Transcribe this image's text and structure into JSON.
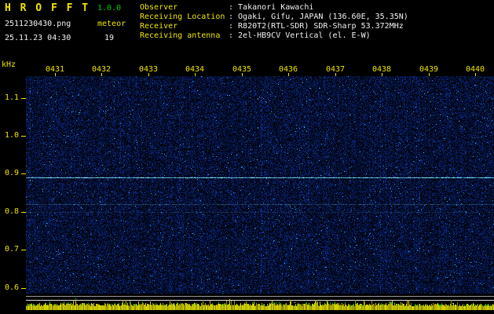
{
  "app": {
    "title": "H R O F F T",
    "version": "1.0.0",
    "filename": "2511230430.png",
    "mode_label": "meteor",
    "datetime": "25.11.23 04:30",
    "echo_count": "19"
  },
  "info": {
    "separator": ":",
    "rows": [
      {
        "label": "Observer",
        "value": "Takanori Kawachi"
      },
      {
        "label": "Receiving Location",
        "value": "Ogaki, Gifu, JAPAN (136.60E, 35.35N)"
      },
      {
        "label": "Receiver",
        "value": "R820T2(RTL-SDR) SDR-Sharp 53.372MHz"
      },
      {
        "label": "Receiving antenna",
        "value": "2el-HB9CV Vertical (el. E-W)"
      }
    ]
  },
  "colors": {
    "background": "#000000",
    "label_yellow": "#f0e300",
    "version_green": "#00cc00",
    "text_white": "#f2f2f2",
    "noise_blue": "#1414b4",
    "carrier_cyan": "#64e6ff",
    "strip_yellow": "#d2d200",
    "strip_green": "#00b400",
    "ref_line_gray": "#9a9a9a",
    "ref_line_white": "#e6e6e6"
  },
  "chart_data": {
    "type": "heatmap",
    "title": "HROFFT 10-minute radio meteor echo spectrogram",
    "x_tick_labels": [
      "0431",
      "0432",
      "0433",
      "0434",
      "0435",
      "0436",
      "0437",
      "0438",
      "0439",
      "0440"
    ],
    "x_axis_note": "time of day (hhmm), 1-minute intervals, 25.11.23 04:30-04:40",
    "ylabel": "kHz",
    "y_tick_labels": [
      "1.1",
      "1.0",
      "0.9",
      "0.8",
      "0.7",
      "0.6"
    ],
    "y_ticks_khz": [
      1.1,
      1.0,
      0.9,
      0.8,
      0.7,
      0.6
    ],
    "ylim_khz": [
      0.585,
      1.157
    ],
    "grid": false,
    "legend": false,
    "background_note": "dark blue random noise speckle field",
    "carrier_lines": [
      {
        "khz": 0.89,
        "strength": 1.0,
        "appearance": "bright continuous cyan carrier line"
      },
      {
        "khz": 0.82,
        "strength": 0.3,
        "appearance": "faint intermittent cyan line"
      },
      {
        "khz": 0.8,
        "strength": 0.16,
        "appearance": "very faint intermittent cyan line"
      }
    ],
    "bottom_strip_note": "yellow signal-level noise band with green flecks and two horizontal reference lines"
  }
}
